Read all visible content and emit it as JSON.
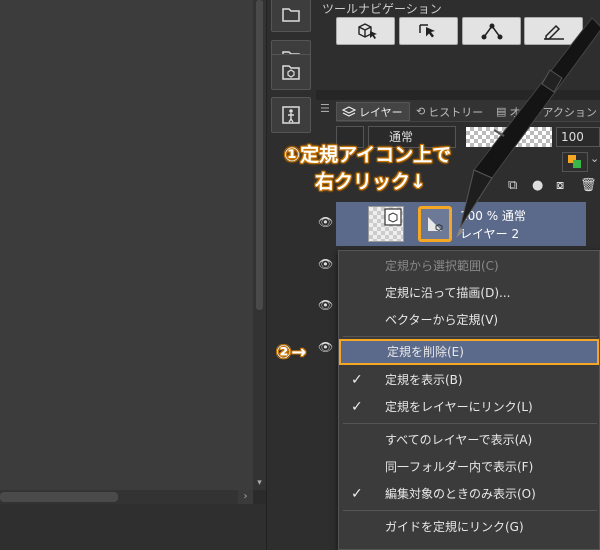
{
  "tool_navigation": {
    "title": "ツールナビゲーション",
    "buttons": [
      {
        "icon": "cube-cursor-icon"
      },
      {
        "icon": "object-select-icon"
      },
      {
        "icon": "vector-edit-icon"
      },
      {
        "icon": "pen-line-icon"
      }
    ]
  },
  "sidebar": {
    "buttons": [
      {
        "icon": "folder-icon"
      },
      {
        "icon": "heart-folder-icon"
      },
      {
        "icon": "cube-box-icon"
      },
      {
        "icon": "figure-icon"
      }
    ]
  },
  "layer_panel": {
    "tabs": [
      "レイヤー",
      "ヒストリー",
      "オートアクション"
    ],
    "blend_mode": "通常",
    "opacity": "100",
    "layer": {
      "line1": "100 % 通常",
      "line2": "レイヤー 2"
    }
  },
  "context_menu": {
    "items": [
      {
        "label": "定規から選択範囲(C)",
        "enabled": false,
        "checked": false
      },
      {
        "label": "定規に沿って描画(D)...",
        "enabled": true,
        "checked": false
      },
      {
        "label": "ベクターから定規(V)",
        "enabled": true,
        "checked": false
      },
      {
        "label": "定規を削除(E)",
        "enabled": true,
        "checked": false,
        "highlighted": true
      },
      {
        "label": "定規を表示(B)",
        "enabled": true,
        "checked": true
      },
      {
        "label": "定規をレイヤーにリンク(L)",
        "enabled": true,
        "checked": true
      },
      {
        "label": "すべてのレイヤーで表示(A)",
        "enabled": true,
        "checked": false
      },
      {
        "label": "同一フォルダー内で表示(F)",
        "enabled": true,
        "checked": false
      },
      {
        "label": "編集対象のときのみ表示(O)",
        "enabled": true,
        "checked": true
      },
      {
        "label": "ガイドを定規にリンク(G)",
        "enabled": true,
        "checked": false
      }
    ]
  },
  "annotations": {
    "step1_line1": "①定規アイコン上で",
    "step1_line2": "右クリック↓",
    "step2": "②→"
  },
  "colors": {
    "highlight_outline": "#f5a623",
    "selected_row": "#5b6a8a",
    "menu_bg": "#3b3b3b"
  }
}
